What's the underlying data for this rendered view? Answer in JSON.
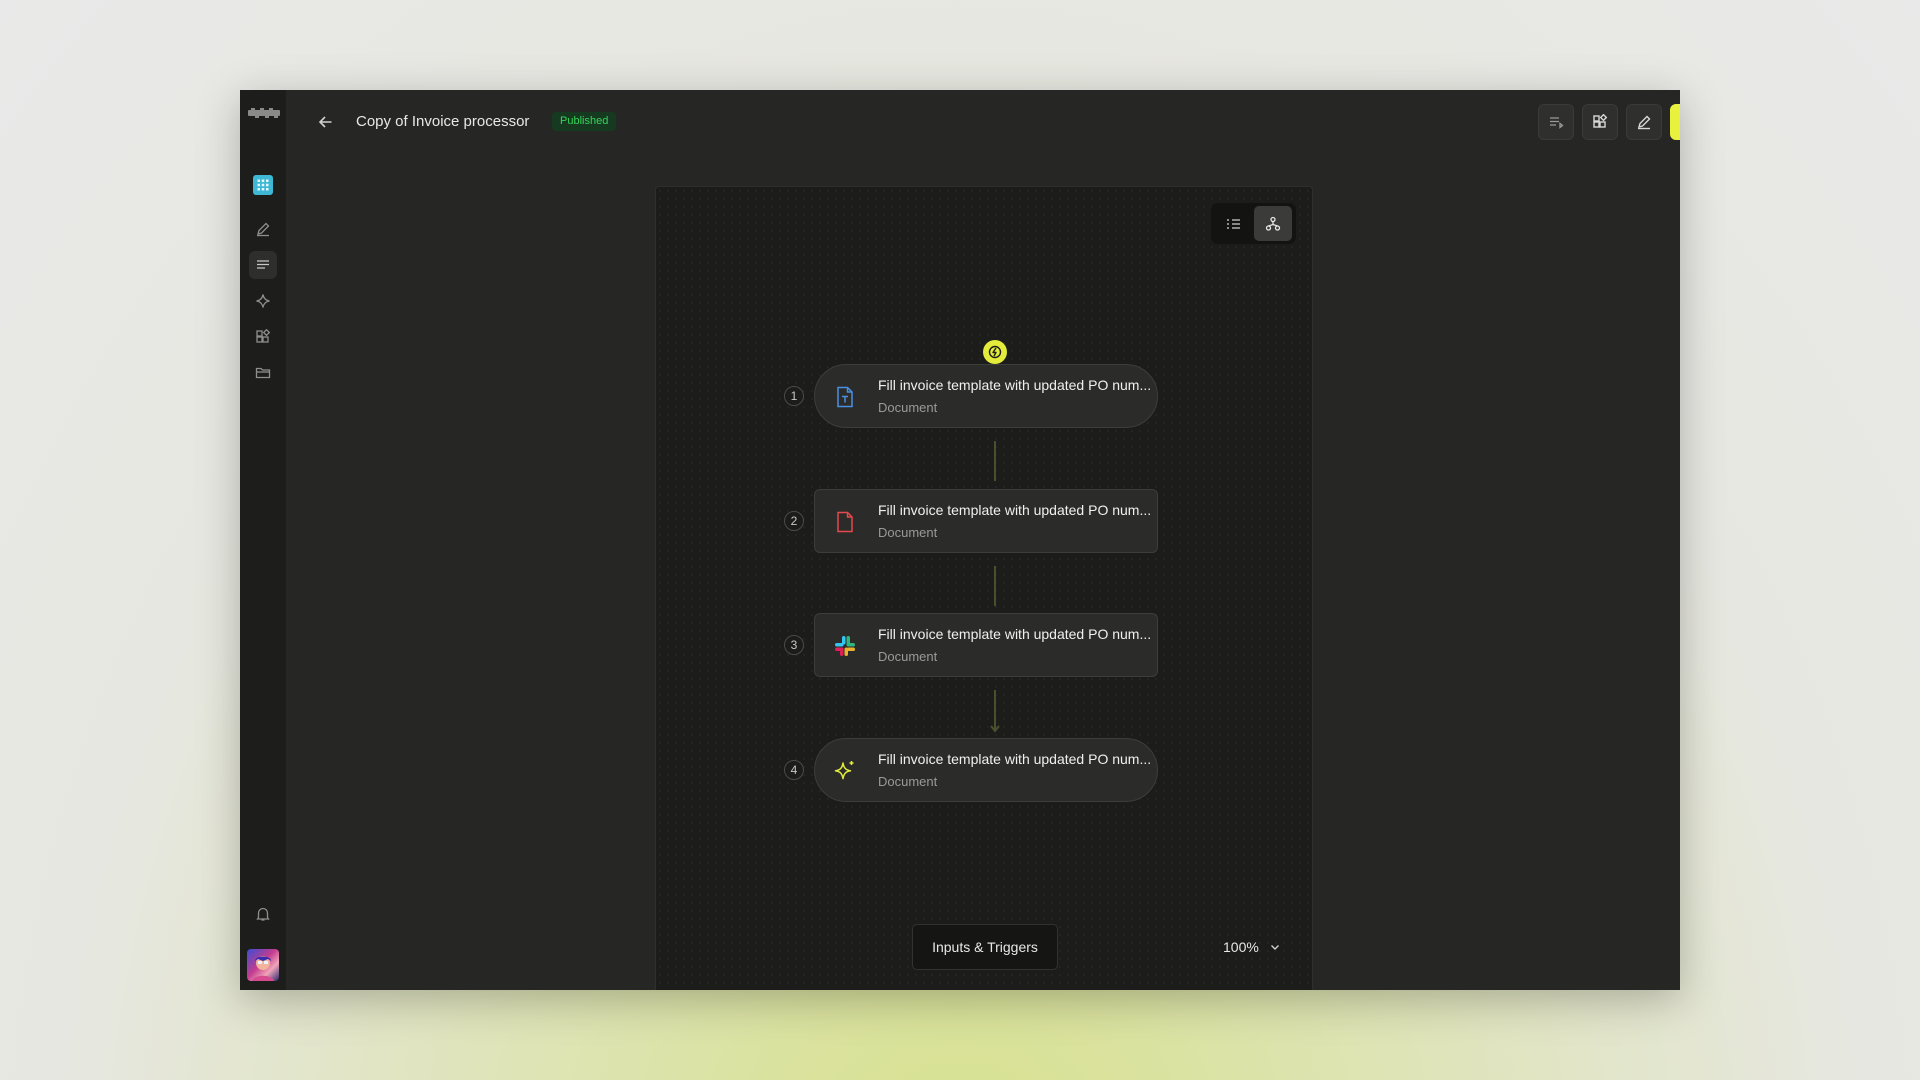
{
  "header": {
    "title": "Copy of Invoice processor",
    "status_badge": "Published"
  },
  "sidebar": {
    "items": [
      {
        "icon": "grid-icon",
        "active": false
      },
      {
        "icon": "pencil-icon",
        "active": false
      },
      {
        "icon": "list-icon",
        "active": true
      },
      {
        "icon": "sparkle-icon",
        "active": false
      },
      {
        "icon": "apps-icon",
        "active": false
      },
      {
        "icon": "folder-icon",
        "active": false
      }
    ],
    "bottom": [
      {
        "icon": "bell-icon"
      },
      {
        "icon": "avatar"
      }
    ]
  },
  "toolbar": {
    "buttons": [
      "logs-icon",
      "apps-icon",
      "edit-icon",
      "run-icon"
    ],
    "accent": "#e8f23c"
  },
  "canvas": {
    "view_modes": [
      "list-view-icon",
      "graph-view-icon"
    ],
    "selected_view": "graph",
    "steps": [
      {
        "number": "1",
        "title": "Fill invoice template with updated PO num...",
        "subtitle": "Document",
        "icon": "document-text-icon"
      },
      {
        "number": "2",
        "title": "Fill invoice template with updated PO num...",
        "subtitle": "Document",
        "icon": "pdf-file-icon"
      },
      {
        "number": "3",
        "title": "Fill invoice template with updated PO num...",
        "subtitle": "Document",
        "icon": "slack-icon"
      },
      {
        "number": "4",
        "title": "Fill invoice template with updated PO num...",
        "subtitle": "Document",
        "icon": "ai-sparkle-icon"
      }
    ],
    "inputs_button": "Inputs & Triggers",
    "zoom": "100%"
  }
}
